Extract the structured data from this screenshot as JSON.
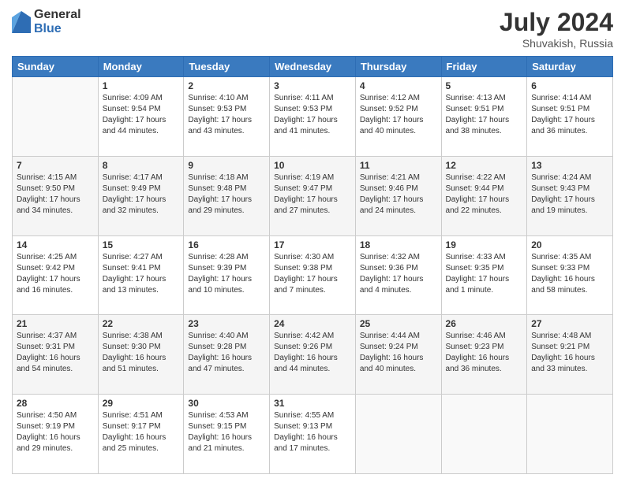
{
  "header": {
    "logo_general": "General",
    "logo_blue": "Blue",
    "main_title": "July 2024",
    "subtitle": "Shuvakish, Russia"
  },
  "days_of_week": [
    "Sunday",
    "Monday",
    "Tuesday",
    "Wednesday",
    "Thursday",
    "Friday",
    "Saturday"
  ],
  "weeks": [
    [
      {
        "day": "",
        "info": ""
      },
      {
        "day": "1",
        "info": "Sunrise: 4:09 AM\nSunset: 9:54 PM\nDaylight: 17 hours\nand 44 minutes."
      },
      {
        "day": "2",
        "info": "Sunrise: 4:10 AM\nSunset: 9:53 PM\nDaylight: 17 hours\nand 43 minutes."
      },
      {
        "day": "3",
        "info": "Sunrise: 4:11 AM\nSunset: 9:53 PM\nDaylight: 17 hours\nand 41 minutes."
      },
      {
        "day": "4",
        "info": "Sunrise: 4:12 AM\nSunset: 9:52 PM\nDaylight: 17 hours\nand 40 minutes."
      },
      {
        "day": "5",
        "info": "Sunrise: 4:13 AM\nSunset: 9:51 PM\nDaylight: 17 hours\nand 38 minutes."
      },
      {
        "day": "6",
        "info": "Sunrise: 4:14 AM\nSunset: 9:51 PM\nDaylight: 17 hours\nand 36 minutes."
      }
    ],
    [
      {
        "day": "7",
        "info": "Sunrise: 4:15 AM\nSunset: 9:50 PM\nDaylight: 17 hours\nand 34 minutes."
      },
      {
        "day": "8",
        "info": "Sunrise: 4:17 AM\nSunset: 9:49 PM\nDaylight: 17 hours\nand 32 minutes."
      },
      {
        "day": "9",
        "info": "Sunrise: 4:18 AM\nSunset: 9:48 PM\nDaylight: 17 hours\nand 29 minutes."
      },
      {
        "day": "10",
        "info": "Sunrise: 4:19 AM\nSunset: 9:47 PM\nDaylight: 17 hours\nand 27 minutes."
      },
      {
        "day": "11",
        "info": "Sunrise: 4:21 AM\nSunset: 9:46 PM\nDaylight: 17 hours\nand 24 minutes."
      },
      {
        "day": "12",
        "info": "Sunrise: 4:22 AM\nSunset: 9:44 PM\nDaylight: 17 hours\nand 22 minutes."
      },
      {
        "day": "13",
        "info": "Sunrise: 4:24 AM\nSunset: 9:43 PM\nDaylight: 17 hours\nand 19 minutes."
      }
    ],
    [
      {
        "day": "14",
        "info": "Sunrise: 4:25 AM\nSunset: 9:42 PM\nDaylight: 17 hours\nand 16 minutes."
      },
      {
        "day": "15",
        "info": "Sunrise: 4:27 AM\nSunset: 9:41 PM\nDaylight: 17 hours\nand 13 minutes."
      },
      {
        "day": "16",
        "info": "Sunrise: 4:28 AM\nSunset: 9:39 PM\nDaylight: 17 hours\nand 10 minutes."
      },
      {
        "day": "17",
        "info": "Sunrise: 4:30 AM\nSunset: 9:38 PM\nDaylight: 17 hours\nand 7 minutes."
      },
      {
        "day": "18",
        "info": "Sunrise: 4:32 AM\nSunset: 9:36 PM\nDaylight: 17 hours\nand 4 minutes."
      },
      {
        "day": "19",
        "info": "Sunrise: 4:33 AM\nSunset: 9:35 PM\nDaylight: 17 hours\nand 1 minute."
      },
      {
        "day": "20",
        "info": "Sunrise: 4:35 AM\nSunset: 9:33 PM\nDaylight: 16 hours\nand 58 minutes."
      }
    ],
    [
      {
        "day": "21",
        "info": "Sunrise: 4:37 AM\nSunset: 9:31 PM\nDaylight: 16 hours\nand 54 minutes."
      },
      {
        "day": "22",
        "info": "Sunrise: 4:38 AM\nSunset: 9:30 PM\nDaylight: 16 hours\nand 51 minutes."
      },
      {
        "day": "23",
        "info": "Sunrise: 4:40 AM\nSunset: 9:28 PM\nDaylight: 16 hours\nand 47 minutes."
      },
      {
        "day": "24",
        "info": "Sunrise: 4:42 AM\nSunset: 9:26 PM\nDaylight: 16 hours\nand 44 minutes."
      },
      {
        "day": "25",
        "info": "Sunrise: 4:44 AM\nSunset: 9:24 PM\nDaylight: 16 hours\nand 40 minutes."
      },
      {
        "day": "26",
        "info": "Sunrise: 4:46 AM\nSunset: 9:23 PM\nDaylight: 16 hours\nand 36 minutes."
      },
      {
        "day": "27",
        "info": "Sunrise: 4:48 AM\nSunset: 9:21 PM\nDaylight: 16 hours\nand 33 minutes."
      }
    ],
    [
      {
        "day": "28",
        "info": "Sunrise: 4:50 AM\nSunset: 9:19 PM\nDaylight: 16 hours\nand 29 minutes."
      },
      {
        "day": "29",
        "info": "Sunrise: 4:51 AM\nSunset: 9:17 PM\nDaylight: 16 hours\nand 25 minutes."
      },
      {
        "day": "30",
        "info": "Sunrise: 4:53 AM\nSunset: 9:15 PM\nDaylight: 16 hours\nand 21 minutes."
      },
      {
        "day": "31",
        "info": "Sunrise: 4:55 AM\nSunset: 9:13 PM\nDaylight: 16 hours\nand 17 minutes."
      },
      {
        "day": "",
        "info": ""
      },
      {
        "day": "",
        "info": ""
      },
      {
        "day": "",
        "info": ""
      }
    ]
  ]
}
